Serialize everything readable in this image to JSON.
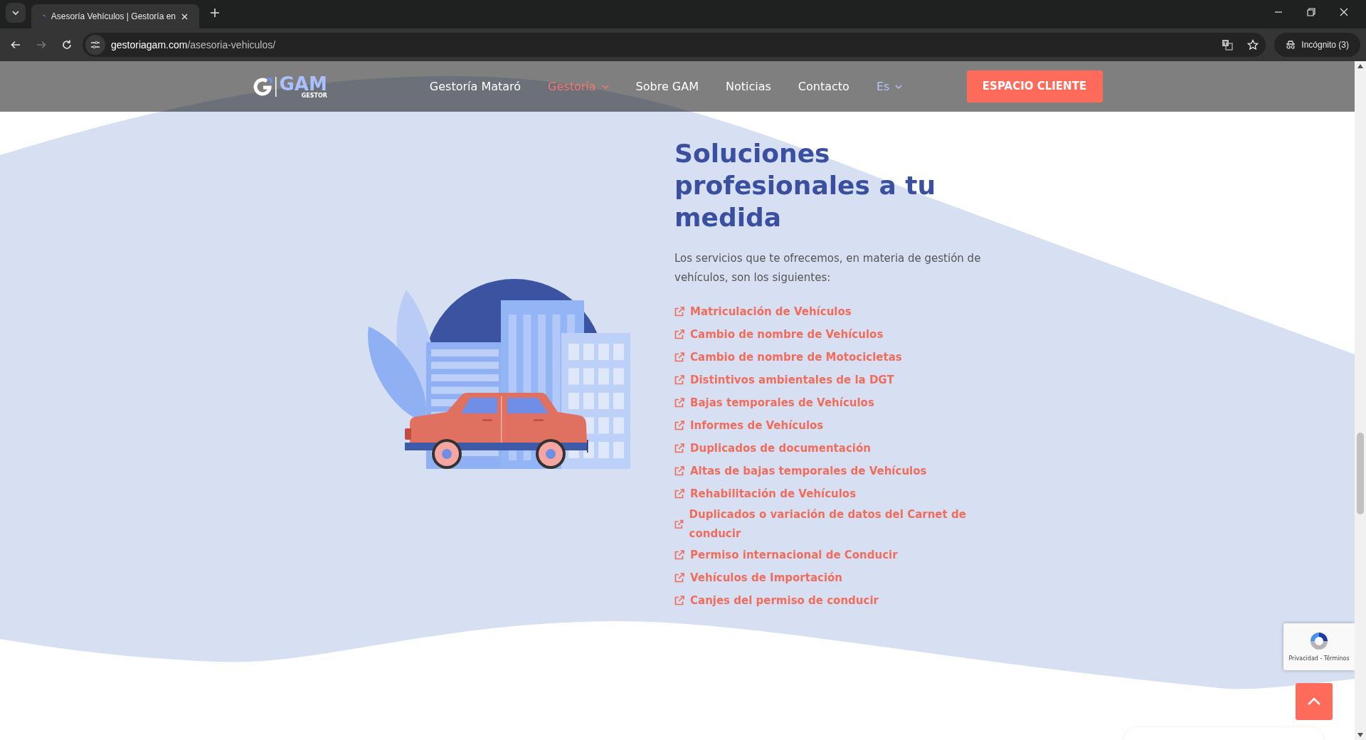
{
  "browser": {
    "tab_title": "Asesoría Vehículos | Gestoría en",
    "url_host": "gestoriagam.com",
    "url_path": "/asesoria-vehiculos/",
    "profile": "Incógnito (3)",
    "nav_buttons": [
      {
        "kind": "back",
        "disabled": false
      },
      {
        "kind": "forward",
        "disabled": true
      },
      {
        "kind": "reload",
        "disabled": false
      }
    ]
  },
  "header": {
    "logo_text": "GAM",
    "logo_subtext": "GESTOR",
    "nav": [
      {
        "label": "Gestoría Mataró",
        "selected": false,
        "dropdown": false
      },
      {
        "label": "Gestoría",
        "selected": true,
        "dropdown": true
      },
      {
        "label": "Sobre GAM",
        "selected": false,
        "dropdown": false
      },
      {
        "label": "Noticias",
        "selected": false,
        "dropdown": false
      },
      {
        "label": "Contacto",
        "selected": false,
        "dropdown": false
      }
    ],
    "language": "Es",
    "cta": "ESPACIO CLIENTE"
  },
  "content": {
    "heading": "Soluciones profesionales a tu medida",
    "intro": "Los servicios que te ofrecemos, en materia de gestión de vehículos, son los siguientes:",
    "services": [
      "Matriculación de Vehículos",
      "Cambio de nombre de Vehículos",
      "Cambio de nombre de Motocicletas",
      "Distintivos ambientales de la DGT",
      "Bajas temporales de Vehículos",
      "Informes de Vehículos",
      "Duplicados de documentación",
      "Altas de bajas temporales de Vehículos",
      "Rehabilitación de Vehículos",
      "Duplicados o variación de datos del Carnet de conducir",
      "Permiso internacional de Conducir",
      "Vehículos de Importación",
      "Canjes del permiso de conducir"
    ]
  },
  "recaptcha": {
    "links": "Privacidad - Términos"
  }
}
